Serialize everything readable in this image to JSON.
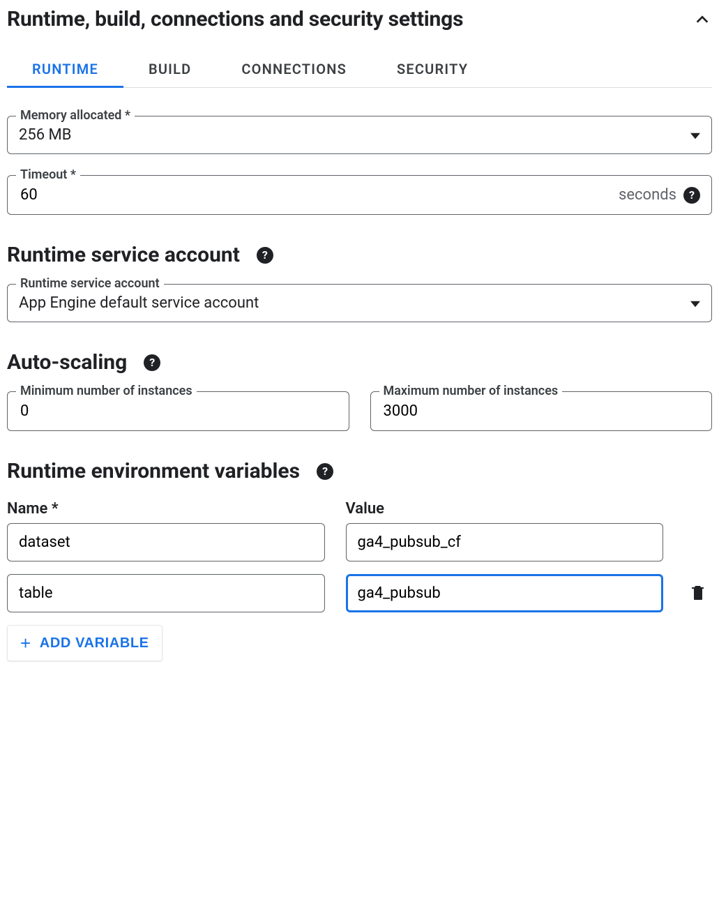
{
  "header": {
    "title": "Runtime, build, connections and security settings"
  },
  "tabs": {
    "runtime": "RUNTIME",
    "build": "BUILD",
    "connections": "CONNECTIONS",
    "security": "SECURITY"
  },
  "memory": {
    "label": "Memory allocated *",
    "value": "256 MB"
  },
  "timeout": {
    "label": "Timeout *",
    "value": "60",
    "suffix": "seconds"
  },
  "service_account": {
    "heading": "Runtime service account",
    "field_label": "Runtime service account",
    "value": "App Engine default service account"
  },
  "autoscaling": {
    "heading": "Auto-scaling",
    "min_label": "Minimum number of instances",
    "min_value": "0",
    "max_label": "Maximum number of instances",
    "max_value": "3000"
  },
  "env": {
    "heading": "Runtime environment variables",
    "name_col": "Name *",
    "value_col": "Value",
    "rows": [
      {
        "name": "dataset",
        "value": "ga4_pubsub_cf"
      },
      {
        "name": "table",
        "value": "ga4_pubsub"
      }
    ],
    "add_button": "ADD VARIABLE"
  }
}
